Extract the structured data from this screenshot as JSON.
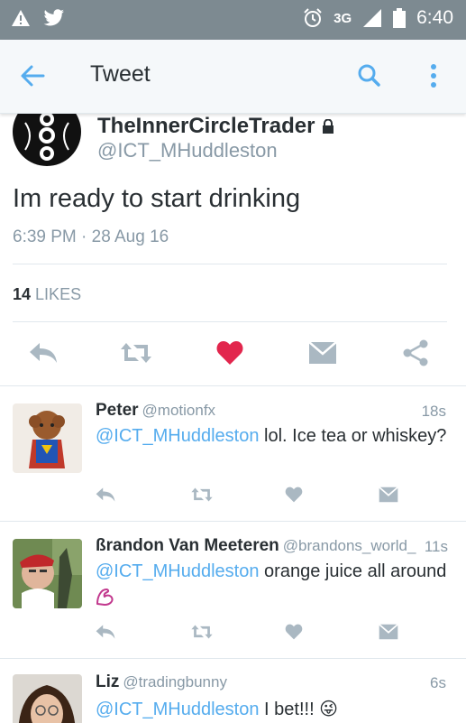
{
  "status_bar": {
    "network": "3G",
    "time": "6:40"
  },
  "app_bar": {
    "title": "Tweet"
  },
  "tweet": {
    "author_name": "TheInnerCircleTrader",
    "author_handle": "@ICT_MHuddleston",
    "text": "Im ready to start drinking",
    "timestamp": "6:39 PM · 28 Aug 16",
    "likes_count": "14",
    "likes_label": "LIKES",
    "liked": true
  },
  "replies": [
    {
      "name": "Peter",
      "handle": "@motionfx",
      "ago": "18s",
      "mention": "@ICT_MHuddleston",
      "text": " lol. Ice tea or whiskey?"
    },
    {
      "name": "ßrandon Van Meeteren",
      "handle": "@brandons_world_",
      "ago": "11s",
      "mention": "@ICT_MHuddleston",
      "text": " orange juice all around"
    },
    {
      "name": "Liz",
      "handle": "@tradingbunny",
      "ago": "6s",
      "mention": "@ICT_MHuddleston",
      "text": " I bet!!! 😜"
    }
  ],
  "colors": {
    "status_bar": "#7d8a91",
    "accent": "#55acee",
    "like": "#e2264d",
    "muted": "#8899a6"
  }
}
